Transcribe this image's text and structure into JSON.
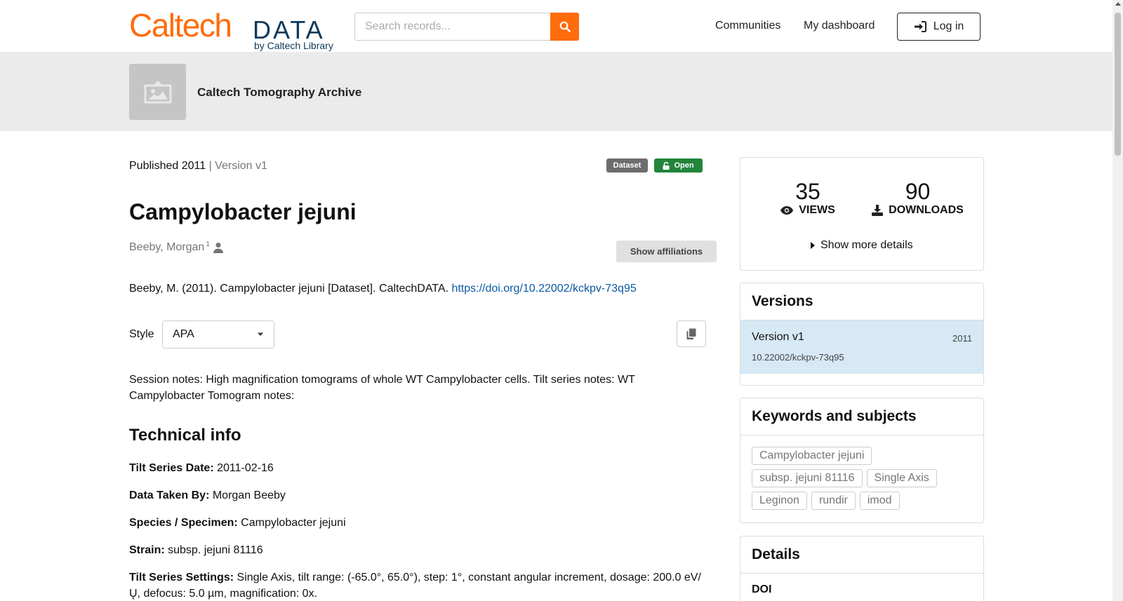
{
  "header": {
    "logo_caltech": "Caltech",
    "logo_data": "DATA",
    "logo_sub": "by Caltech Library",
    "search_placeholder": "Search records...",
    "nav_communities": "Communities",
    "nav_dashboard": "My dashboard",
    "login_label": "Log in"
  },
  "community": {
    "name": "Caltech Tomography Archive"
  },
  "record": {
    "published": "Published 2011",
    "separator": " | ",
    "version": "Version v1",
    "badge_type": "Dataset",
    "badge_access": "Open",
    "title": "Campylobacter jejuni",
    "creator": "Beeby, Morgan",
    "creator_aff": "1",
    "show_affiliations": "Show affiliations",
    "citation_text": "Beeby, M. (2011). Campylobacter jejuni [Dataset]. CaltechDATA. ",
    "citation_link": "https://doi.org/10.22002/kckpv-73q95",
    "style_label": "Style",
    "style_value": "APA",
    "description": "Session notes: High magnification tomograms of whole WT Campylobacter cells. Tilt series notes: WT Campylobacter Tomogram notes:"
  },
  "technical": {
    "heading": "Technical info",
    "fields": [
      {
        "label": "Tilt Series Date:",
        "value": " 2011-02-16"
      },
      {
        "label": "Data Taken By:",
        "value": " Morgan Beeby"
      },
      {
        "label": "Species / Specimen:",
        "value": " Campylobacter jejuni"
      },
      {
        "label": "Strain:",
        "value": " subsp. jejuni 81116"
      },
      {
        "label": "Tilt Series Settings:",
        "value": " Single Axis, tilt range: (-65.0°, 65.0°), step: 1°, constant angular increment, dosage: 200.0 eV/Ų, defocus: 5.0 µm, magnification: 0x."
      }
    ]
  },
  "stats": {
    "views": "35",
    "views_label": "VIEWS",
    "downloads": "90",
    "downloads_label": "DOWNLOADS",
    "more_details": "Show more details"
  },
  "versions": {
    "heading": "Versions",
    "items": [
      {
        "name": "Version v1",
        "year": "2011",
        "doi": "10.22002/kckpv-73q95"
      }
    ]
  },
  "keywords": {
    "heading": "Keywords and subjects",
    "items": [
      "Campylobacter jejuni",
      "subsp. jejuni 81116",
      "Single Axis",
      "Leginon",
      "rundir",
      "imod"
    ]
  },
  "details": {
    "heading": "Details",
    "doi_label": "DOI"
  },
  "colors": {
    "brand_orange": "#ff6c0c",
    "brand_navy": "#0c3a5c",
    "open_green": "#21853a",
    "link_blue": "#0b5aa2",
    "version_highlight": "#d6e9f5"
  }
}
